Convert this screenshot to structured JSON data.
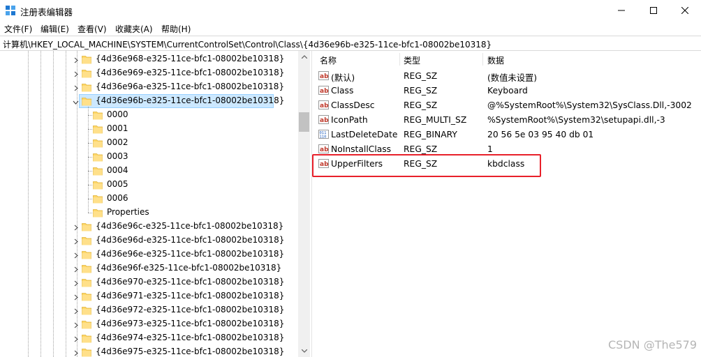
{
  "window": {
    "title": "注册表编辑器"
  },
  "menu": [
    "文件(F)",
    "编辑(E)",
    "查看(V)",
    "收藏夹(A)",
    "帮助(H)"
  ],
  "address": "计算机\\HKEY_LOCAL_MACHINE\\SYSTEM\\CurrentControlSet\\Control\\Class\\{4d36e96b-e325-11ce-bfc1-08002be10318}",
  "tree": {
    "before": [
      "{4d36e968-e325-11ce-bfc1-08002be10318}",
      "{4d36e969-e325-11ce-bfc1-08002be10318}",
      "{4d36e96a-e325-11ce-bfc1-08002be10318}"
    ],
    "selected": "{4d36e96b-e325-11ce-bfc1-08002be10318}",
    "children": [
      "0000",
      "0001",
      "0002",
      "0003",
      "0004",
      "0005",
      "0006",
      "Properties"
    ],
    "after": [
      "{4d36e96c-e325-11ce-bfc1-08002be10318}",
      "{4d36e96d-e325-11ce-bfc1-08002be10318}",
      "{4d36e96e-e325-11ce-bfc1-08002be10318}",
      "{4d36e96f-e325-11ce-bfc1-08002be10318}",
      "{4d36e970-e325-11ce-bfc1-08002be10318}",
      "{4d36e971-e325-11ce-bfc1-08002be10318}",
      "{4d36e972-e325-11ce-bfc1-08002be10318}",
      "{4d36e973-e325-11ce-bfc1-08002be10318}",
      "{4d36e974-e325-11ce-bfc1-08002be10318}",
      "{4d36e975-e325-11ce-bfc1-08002be10318}"
    ]
  },
  "columns": {
    "name": "名称",
    "type": "类型",
    "data": "数据"
  },
  "values": [
    {
      "name": "(默认)",
      "type": "REG_SZ",
      "data": "(数值未设置)",
      "icon": "string-value-icon"
    },
    {
      "name": "Class",
      "type": "REG_SZ",
      "data": "Keyboard",
      "icon": "string-value-icon"
    },
    {
      "name": "ClassDesc",
      "type": "REG_SZ",
      "data": "@%SystemRoot%\\System32\\SysClass.Dll,-3002",
      "icon": "string-value-icon"
    },
    {
      "name": "IconPath",
      "type": "REG_MULTI_SZ",
      "data": "%SystemRoot%\\System32\\setupapi.dll,-3",
      "icon": "string-value-icon"
    },
    {
      "name": "LastDeleteDate",
      "type": "REG_BINARY",
      "data": "20 56 5e 03 95 40 db 01",
      "icon": "binary-value-icon"
    },
    {
      "name": "NoInstallClass",
      "type": "REG_SZ",
      "data": "1",
      "icon": "string-value-icon"
    },
    {
      "name": "UpperFilters",
      "type": "REG_SZ",
      "data": "kbdclass",
      "icon": "string-value-icon"
    }
  ],
  "highlight_color": "#e8202a",
  "watermark": "CSDN @The579"
}
